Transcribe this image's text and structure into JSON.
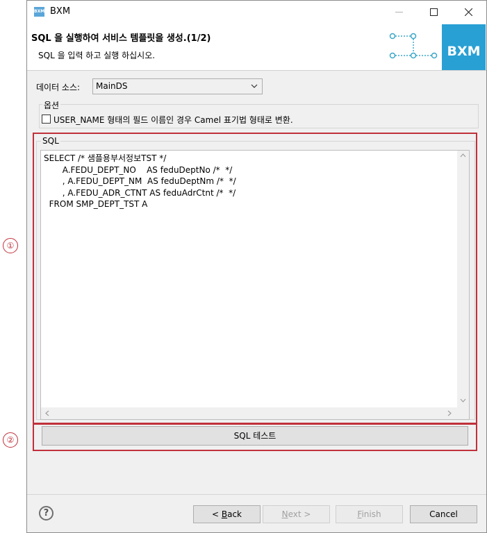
{
  "window": {
    "title": "BXM",
    "icon_text": "BXM"
  },
  "header": {
    "title": "SQL 을 실행하여 서비스 템플릿을 생성.(1/2)",
    "description": "SQL 을 입력 하고 실행 하십시오.",
    "logo_text": "BXM"
  },
  "datasource": {
    "label": "데이터 소스:",
    "value": "MainDS"
  },
  "options": {
    "legend": "옵션",
    "camel_checkbox_label": "USER_NAME 형태의 필드 이름인 경우 Camel 표기법 형태로 변환.",
    "camel_checked": false
  },
  "sql": {
    "legend": "SQL",
    "text": "SELECT /* 샘플용부서정보TST */\n       A.FEDU_DEPT_NO    AS feduDeptNo /*  */\n       , A.FEDU_DEPT_NM  AS feduDeptNm /*  */\n       , A.FEDU_ADR_CTNT AS feduAdrCtnt /*  */\n  FROM SMP_DEPT_TST A",
    "test_button": "SQL 테스트"
  },
  "annotations": {
    "marker1": "①",
    "marker2": "②"
  },
  "footer": {
    "help": "?",
    "back_prefix": "< ",
    "back_mnemonic": "B",
    "back_rest": "ack",
    "next_mnemonic": "N",
    "next_rest": "ext >",
    "finish_mnemonic": "F",
    "finish_rest": "inish",
    "cancel": "Cancel"
  }
}
